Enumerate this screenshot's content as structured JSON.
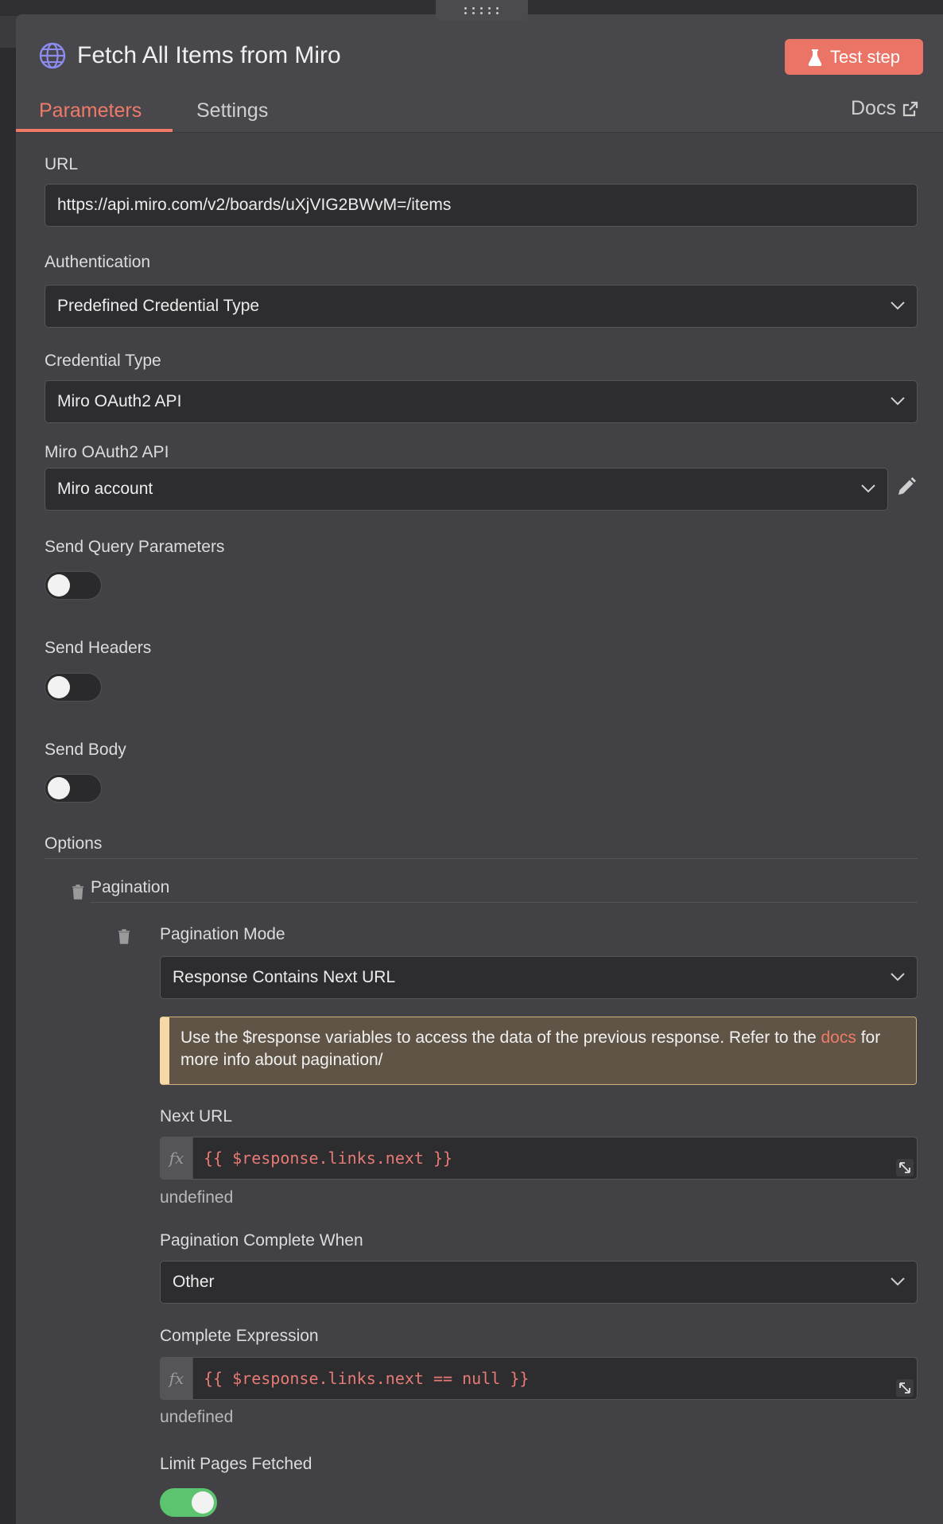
{
  "node": {
    "title": "Fetch All Items from Miro",
    "test_button": "Test step"
  },
  "tabs": [
    {
      "label": "Parameters",
      "active": true
    },
    {
      "label": "Settings",
      "active": false
    }
  ],
  "docs_label": "Docs",
  "fields": {
    "url": {
      "label": "URL",
      "value": "https://api.miro.com/v2/boards/uXjVIG2BWvM=/items"
    },
    "authentication": {
      "label": "Authentication",
      "value": "Predefined Credential Type"
    },
    "credential_type": {
      "label": "Credential Type",
      "value": "Miro OAuth2 API"
    },
    "credential": {
      "label": "Miro OAuth2 API",
      "value": "Miro account"
    },
    "send_query": {
      "label": "Send Query Parameters",
      "on": false
    },
    "send_headers": {
      "label": "Send Headers",
      "on": false
    },
    "send_body": {
      "label": "Send Body",
      "on": false
    }
  },
  "options": {
    "label": "Options",
    "pagination": {
      "label": "Pagination",
      "mode": {
        "label": "Pagination Mode",
        "value": "Response Contains Next URL"
      },
      "notice": {
        "text_before": "Use the $response variables to access the data of the previous response. Refer to the",
        "link": "docs",
        "text_after": "for more info about pagination/"
      },
      "next_url": {
        "label": "Next URL",
        "expression": "{{ $response.links.next }}",
        "result": "undefined"
      },
      "complete_when": {
        "label": "Pagination Complete When",
        "value": "Other"
      },
      "complete_expression": {
        "label": "Complete Expression",
        "expression": "{{ $response.links.next == null }}",
        "result": "undefined"
      },
      "limit_pages": {
        "label": "Limit Pages Fetched",
        "on": true
      }
    }
  },
  "colors": {
    "accent": "#ef7a68",
    "toggle_on": "#5cc46f",
    "panel_bg": "#424246",
    "field_bg": "#2d2d30"
  }
}
